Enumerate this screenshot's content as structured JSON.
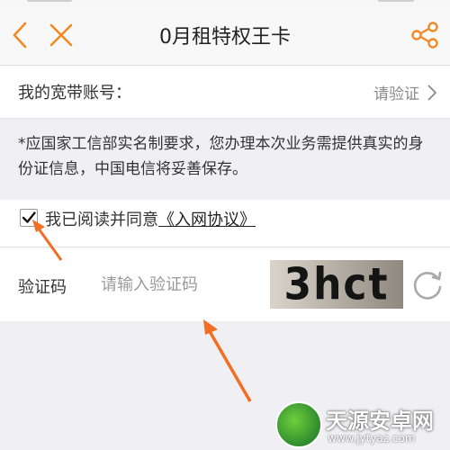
{
  "header": {
    "title": "0月租特权王卡",
    "back_icon": "chevron-left-icon",
    "close_icon": "close-icon",
    "share_icon": "share-icon",
    "accent_color": "#f08a24"
  },
  "account": {
    "label": "我的宽带账号：",
    "action": "请验证"
  },
  "notice": {
    "text": "*应国家工信部实名制要求，您办理本次业务需提供真实的身份证信息，中国电信将妥善保存。"
  },
  "agreement": {
    "checked": true,
    "text": "我已阅读并同意",
    "link": "《入网协议》"
  },
  "verification": {
    "label": "验证码",
    "placeholder": "请输入验证码",
    "captcha_text": "3hct",
    "refresh_icon": "refresh-icon"
  },
  "watermark": {
    "title": "天源安卓网",
    "url": "www.jytyaz.com"
  }
}
